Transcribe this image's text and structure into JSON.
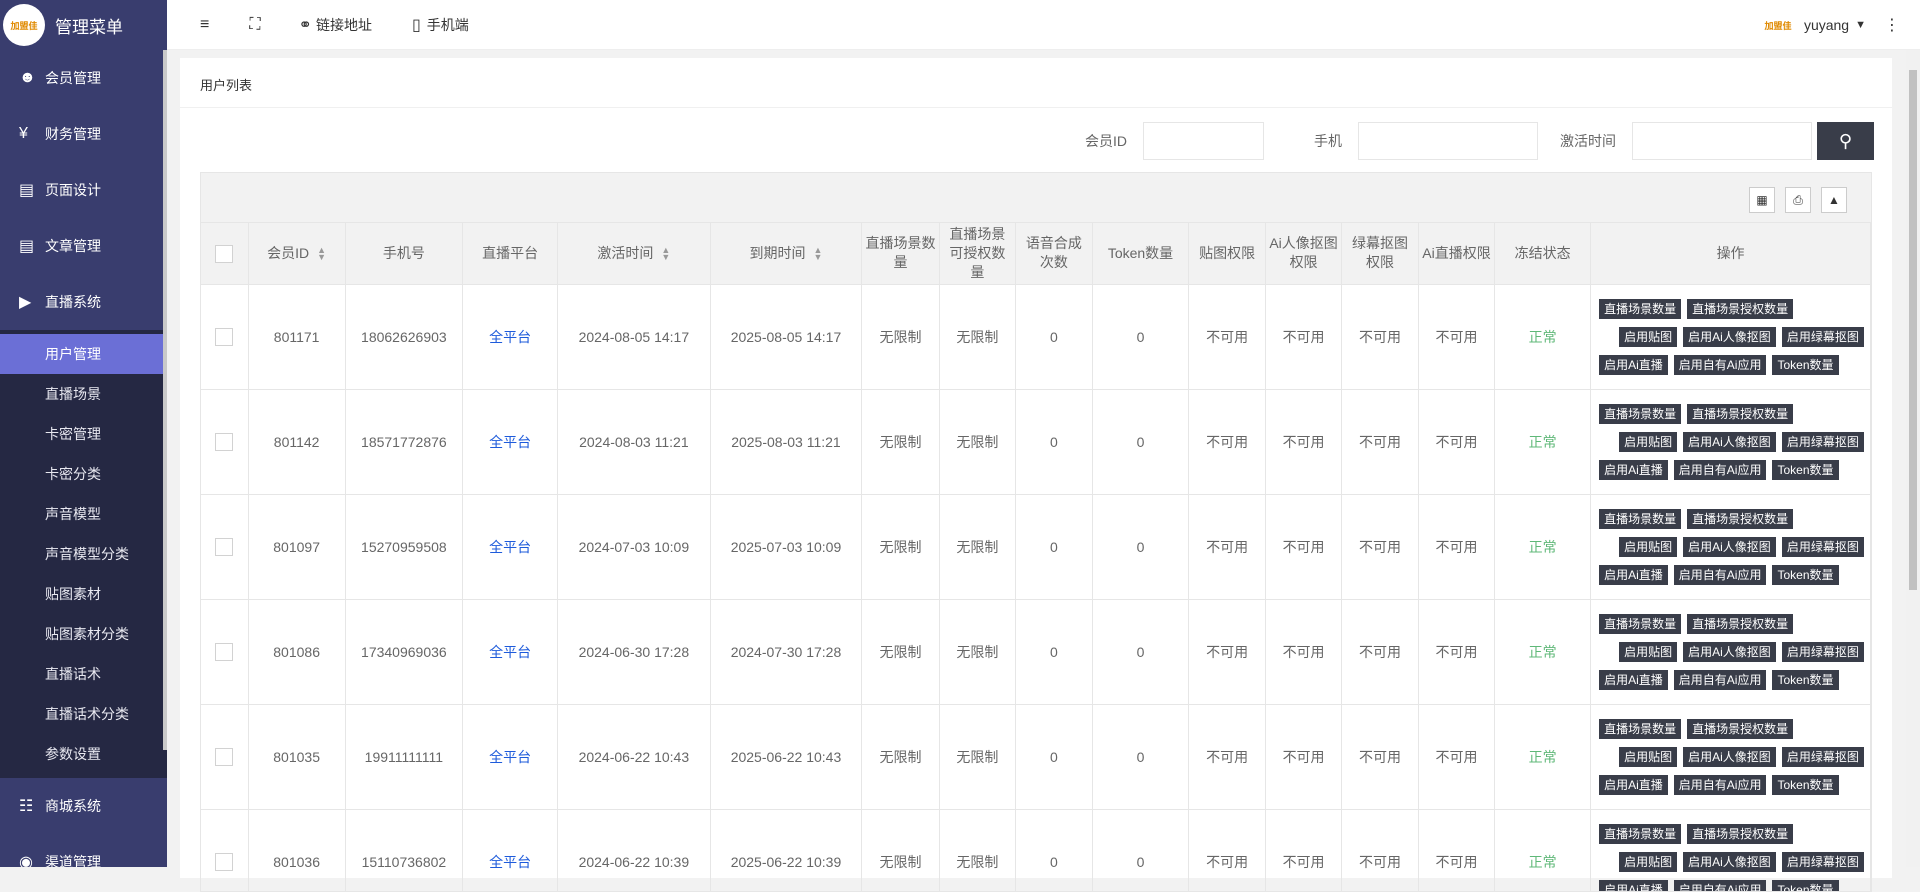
{
  "sidebar": {
    "logo_text": "加盟佳",
    "title": "管理菜单",
    "top_items": [
      {
        "label": "会员管理",
        "icon": "user-icon"
      },
      {
        "label": "财务管理",
        "icon": "yen-icon"
      },
      {
        "label": "页面设计",
        "icon": "layout-icon"
      },
      {
        "label": "文章管理",
        "icon": "document-icon"
      },
      {
        "label": "直播系统",
        "icon": "play-icon"
      }
    ],
    "sub_items": [
      "用户管理",
      "直播场景",
      "卡密管理",
      "卡密分类",
      "声音模型",
      "声音模型分类",
      "贴图素材",
      "贴图素材分类",
      "直播话术",
      "直播话术分类",
      "参数设置"
    ],
    "bottom_items": [
      {
        "label": "商城系统",
        "icon": "cart-icon"
      },
      {
        "label": "渠道管理",
        "icon": "channel-icon"
      }
    ]
  },
  "topbar": {
    "link_label": "链接地址",
    "mobile_label": "手机端",
    "username": "yuyang"
  },
  "page": {
    "title": "用户列表",
    "search": {
      "member_id_label": "会员ID",
      "phone_label": "手机",
      "activate_time_label": "激活时间"
    }
  },
  "table": {
    "headers": [
      "会员ID",
      "手机号",
      "直播平台",
      "激活时间",
      "到期时间",
      "直播场景数量",
      "直播场景可授权数量",
      "语音合成次数",
      "Token数量",
      "贴图权限",
      "Ai人像抠图权限",
      "绿幕抠图权限",
      "Ai直播权限",
      "冻结状态",
      "操作"
    ],
    "op_tags": {
      "row1": [
        "直播场景数量",
        "直播场景授权数量"
      ],
      "row2": [
        "启用贴图",
        "启用Ai人像抠图",
        "启用绿幕抠图"
      ],
      "row3": [
        "启用Ai直播",
        "启用自有Ai应用",
        "Token数量"
      ]
    },
    "rows": [
      {
        "id": "801171",
        "phone": "18062626903",
        "platform": "全平台",
        "activated": "2024-08-05 14:17",
        "expires": "2025-08-05 14:17",
        "scenes": "无限制",
        "auth_scenes": "无限制",
        "tts": "0",
        "tokens": "0",
        "sticker": "不可用",
        "ai_cutout": "不可用",
        "green": "不可用",
        "ai_live": "不可用",
        "status": "正常"
      },
      {
        "id": "801142",
        "phone": "18571772876",
        "platform": "全平台",
        "activated": "2024-08-03 11:21",
        "expires": "2025-08-03 11:21",
        "scenes": "无限制",
        "auth_scenes": "无限制",
        "tts": "0",
        "tokens": "0",
        "sticker": "不可用",
        "ai_cutout": "不可用",
        "green": "不可用",
        "ai_live": "不可用",
        "status": "正常"
      },
      {
        "id": "801097",
        "phone": "15270959508",
        "platform": "全平台",
        "activated": "2024-07-03 10:09",
        "expires": "2025-07-03 10:09",
        "scenes": "无限制",
        "auth_scenes": "无限制",
        "tts": "0",
        "tokens": "0",
        "sticker": "不可用",
        "ai_cutout": "不可用",
        "green": "不可用",
        "ai_live": "不可用",
        "status": "正常"
      },
      {
        "id": "801086",
        "phone": "17340969036",
        "platform": "全平台",
        "activated": "2024-06-30 17:28",
        "expires": "2024-07-30 17:28",
        "scenes": "无限制",
        "auth_scenes": "无限制",
        "tts": "0",
        "tokens": "0",
        "sticker": "不可用",
        "ai_cutout": "不可用",
        "green": "不可用",
        "ai_live": "不可用",
        "status": "正常"
      },
      {
        "id": "801035",
        "phone": "19911111111",
        "platform": "全平台",
        "activated": "2024-06-22 10:43",
        "expires": "2025-06-22 10:43",
        "scenes": "无限制",
        "auth_scenes": "无限制",
        "tts": "0",
        "tokens": "0",
        "sticker": "不可用",
        "ai_cutout": "不可用",
        "green": "不可用",
        "ai_live": "不可用",
        "status": "正常"
      },
      {
        "id": "801036",
        "phone": "15110736802",
        "platform": "全平台",
        "activated": "2024-06-22 10:39",
        "expires": "2025-06-22 10:39",
        "scenes": "无限制",
        "auth_scenes": "无限制",
        "tts": "0",
        "tokens": "0",
        "sticker": "不可用",
        "ai_cutout": "不可用",
        "green": "不可用",
        "ai_live": "不可用",
        "status": "正常"
      }
    ]
  },
  "colors": {
    "sidebar_bg": "#393d6e",
    "active_item": "#6b6fd6",
    "tag_bg": "#393d49",
    "status_ok": "#5fb878",
    "link_blue": "#1e5bdb"
  }
}
